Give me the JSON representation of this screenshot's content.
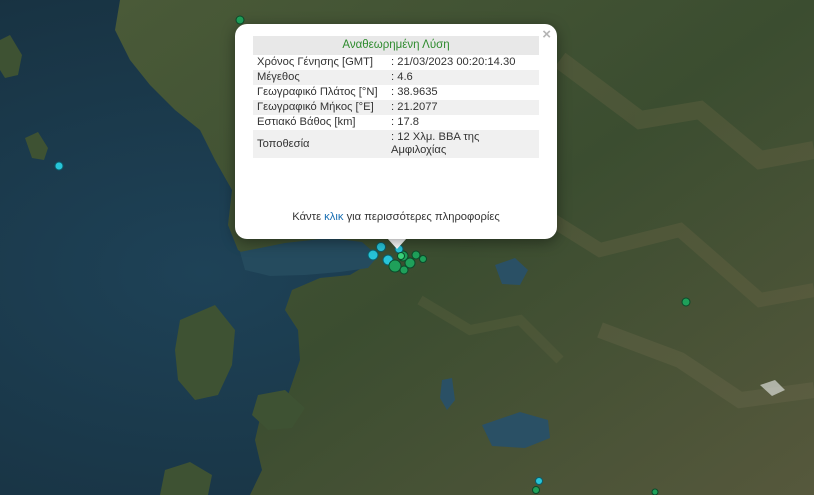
{
  "popup": {
    "title": "Αναθεωρημένη Λύση",
    "close_symbol": "×",
    "rows": [
      {
        "label": "Χρόνος Γένησης [GMT]",
        "value": ": 21/03/2023 00:20:14.30"
      },
      {
        "label": "Μέγεθος",
        "value": ": 4.6"
      },
      {
        "label": "Γεωγραφικό Πλάτος [°N]",
        "value": ": 38.9635"
      },
      {
        "label": "Γεωγραφικό Μήκος [°E]",
        "value": ": 21.2077"
      },
      {
        "label": "Εστιακό Βάθος [km]",
        "value": ": 17.8"
      },
      {
        "label": "Τοποθεσία",
        "value": ": 12 Χλμ. ΒΒΑ της Αμφιλοχίας"
      }
    ],
    "more_prefix": "Κάντε",
    "more_link": "κλικ",
    "more_suffix": "για περισσότερες πληροφορίες"
  },
  "colors": {
    "sea": "#1d3a4c",
    "land": "#3d5132",
    "marker_cyan": "#27c4d8",
    "marker_green": "#1fa05a"
  }
}
